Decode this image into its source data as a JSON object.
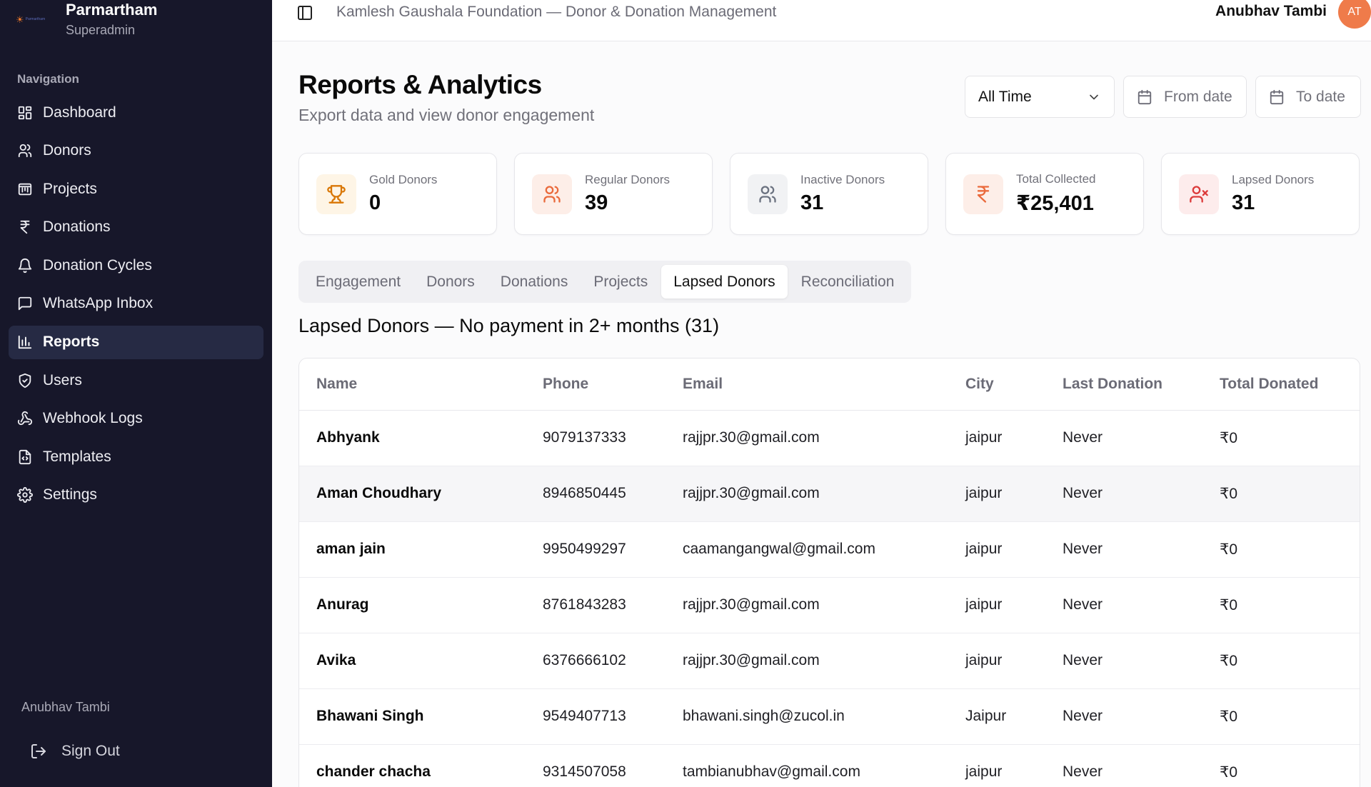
{
  "brand": {
    "name": "Parmartham",
    "role": "Superadmin",
    "logo_text": "Parmartham"
  },
  "sidebar": {
    "heading": "Navigation",
    "items": [
      {
        "label": "Dashboard",
        "icon": "dashboard-icon"
      },
      {
        "label": "Donors",
        "icon": "users-icon"
      },
      {
        "label": "Projects",
        "icon": "projects-icon"
      },
      {
        "label": "Donations",
        "icon": "rupee-icon"
      },
      {
        "label": "Donation Cycles",
        "icon": "bell-icon"
      },
      {
        "label": "WhatsApp Inbox",
        "icon": "message-icon"
      },
      {
        "label": "Reports",
        "icon": "bar-chart-icon",
        "active": true
      },
      {
        "label": "Users",
        "icon": "shield-icon"
      },
      {
        "label": "Webhook Logs",
        "icon": "webhook-icon"
      },
      {
        "label": "Templates",
        "icon": "file-code-icon"
      },
      {
        "label": "Settings",
        "icon": "gear-icon"
      }
    ],
    "user_name": "Anubhav Tambi",
    "signout_label": "Sign Out"
  },
  "header": {
    "org_title": "Kamlesh Gaushala Foundation — Donor & Donation Management",
    "user_name": "Anubhav Tambi",
    "avatar_initials": "AT"
  },
  "page": {
    "title": "Reports & Analytics",
    "subtitle": "Export data and view donor engagement"
  },
  "filters": {
    "period": "All Time",
    "from_placeholder": "From date",
    "to_placeholder": "To date"
  },
  "stats": [
    {
      "label": "Gold Donors",
      "value": "0",
      "icon": "trophy-icon",
      "color": "#d97706",
      "bg": "#fef5e6"
    },
    {
      "label": "Regular Donors",
      "value": "39",
      "icon": "users-icon",
      "color": "#ea6a3c",
      "bg": "#fdeee8"
    },
    {
      "label": "Inactive Donors",
      "value": "31",
      "icon": "users-icon",
      "color": "#6b7280",
      "bg": "#f1f2f4"
    },
    {
      "label": "Total Collected",
      "value": "₹25,401",
      "icon": "rupee-icon",
      "color": "#ea6a3c",
      "bg": "#fdeee8"
    },
    {
      "label": "Lapsed Donors",
      "value": "31",
      "icon": "user-x-icon",
      "color": "#dc3b3b",
      "bg": "#fdecec"
    }
  ],
  "tabs": [
    "Engagement",
    "Donors",
    "Donations",
    "Projects",
    "Lapsed Donors",
    "Reconciliation"
  ],
  "active_tab": "Lapsed Donors",
  "section_title": "Lapsed Donors — No payment in 2+ months (31)",
  "table": {
    "columns": [
      "Name",
      "Phone",
      "Email",
      "City",
      "Last Donation",
      "Total Donated"
    ],
    "rows": [
      [
        "Abhyank",
        "9079137333",
        "rajjpr.30@gmail.com",
        "jaipur",
        "Never",
        "₹0"
      ],
      [
        "Aman Choudhary",
        "8946850445",
        "rajjpr.30@gmail.com",
        "jaipur",
        "Never",
        "₹0"
      ],
      [
        "aman jain",
        "9950499297",
        "caamangangwal@gmail.com",
        "jaipur",
        "Never",
        "₹0"
      ],
      [
        "Anurag",
        "8761843283",
        "rajjpr.30@gmail.com",
        "jaipur",
        "Never",
        "₹0"
      ],
      [
        "Avika",
        "6376666102",
        "rajjpr.30@gmail.com",
        "jaipur",
        "Never",
        "₹0"
      ],
      [
        "Bhawani Singh",
        "9549407713",
        "bhawani.singh@zucol.in",
        "Jaipur",
        "Never",
        "₹0"
      ],
      [
        "chander chacha",
        "9314507058",
        "tambianubhav@gmail.com",
        "jaipur",
        "Never",
        "₹0"
      ]
    ]
  }
}
